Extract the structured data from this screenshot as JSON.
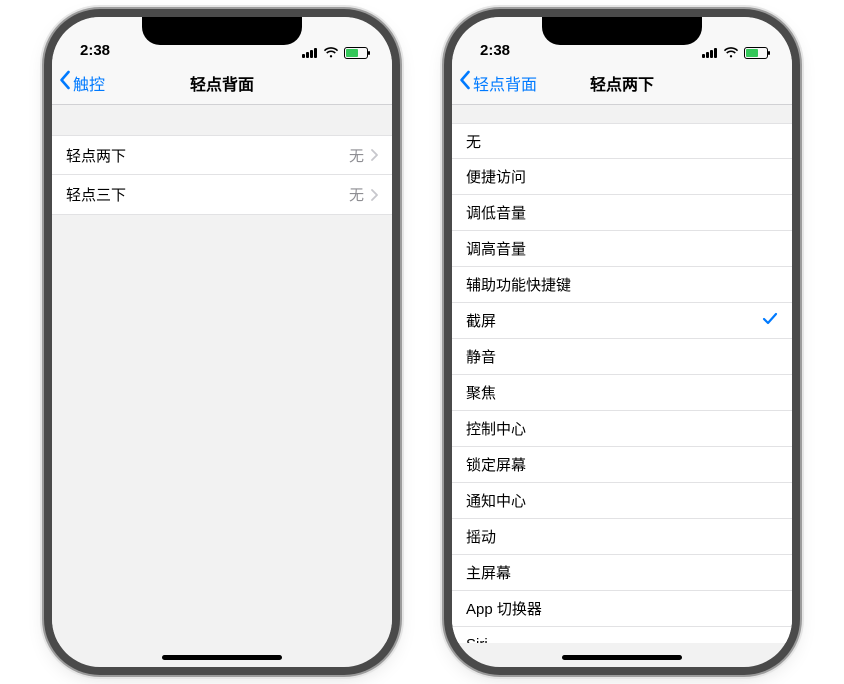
{
  "statusbar": {
    "time": "2:38"
  },
  "left": {
    "back_label": "触控",
    "title": "轻点背面",
    "rows": [
      {
        "label": "轻点两下",
        "value": "无"
      },
      {
        "label": "轻点三下",
        "value": "无"
      }
    ]
  },
  "right": {
    "back_label": "轻点背面",
    "title": "轻点两下",
    "options": [
      {
        "label": "无",
        "selected": false
      },
      {
        "label": "便捷访问",
        "selected": false
      },
      {
        "label": "调低音量",
        "selected": false
      },
      {
        "label": "调高音量",
        "selected": false
      },
      {
        "label": "辅助功能快捷键",
        "selected": false
      },
      {
        "label": "截屏",
        "selected": true
      },
      {
        "label": "静音",
        "selected": false
      },
      {
        "label": "聚焦",
        "selected": false
      },
      {
        "label": "控制中心",
        "selected": false
      },
      {
        "label": "锁定屏幕",
        "selected": false
      },
      {
        "label": "通知中心",
        "selected": false
      },
      {
        "label": "摇动",
        "selected": false
      },
      {
        "label": "主屏幕",
        "selected": false
      },
      {
        "label": "App 切换器",
        "selected": false
      },
      {
        "label": "Siri",
        "selected": false
      }
    ]
  }
}
